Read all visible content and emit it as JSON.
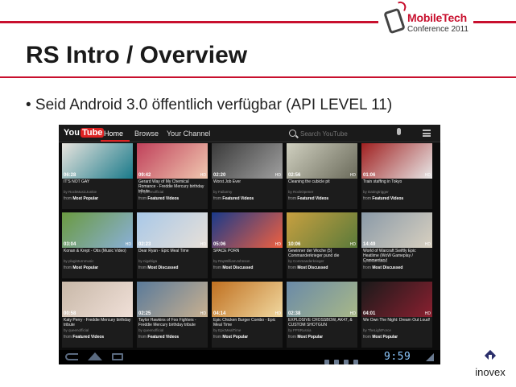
{
  "slide": {
    "title": "RS Intro / Overview",
    "bullet": "• Seid Android 3.0 öffentlich verfügbar (API LEVEL 11)",
    "conference_logo": {
      "line1": "MobileTech",
      "line2": "Conference 2011"
    },
    "company_logo": "inovex",
    "accent_color": "#c8102e"
  },
  "youtube_app": {
    "logo": {
      "you": "You",
      "tube": "Tube"
    },
    "nav_tabs": [
      {
        "label": "Home",
        "active": true
      },
      {
        "label": "Browse",
        "active": false
      },
      {
        "label": "Your Channel",
        "active": false
      }
    ],
    "search": {
      "placeholder": "Search YouTube"
    },
    "videos": [
      {
        "title": "IT'S NOT GAY",
        "duration": "06:28",
        "by": "by RockMusicJunkie",
        "feed_prefix": "from",
        "feed": "Most Popular",
        "hd": "",
        "badge": "",
        "colors": [
          "#e8e4de",
          "#1a7a8a"
        ]
      },
      {
        "title": "Gerard Way of My Chemical Romance - Freddie Mercury birthday tribute",
        "duration": "09:42",
        "by": "by queenofficial",
        "feed_prefix": "from",
        "feed": "Featured Videos",
        "hd": "HD",
        "badge": "",
        "colors": [
          "#c0405a",
          "#f0c8b0"
        ]
      },
      {
        "title": "Worst Job Ever",
        "duration": "02:20",
        "by": "by Failarmy",
        "feed_prefix": "from",
        "feed": "Featured Videos",
        "hd": "HD",
        "badge": "",
        "colors": [
          "#3a3a3a",
          "#a0a0a0"
        ]
      },
      {
        "title": "Cleaning the cubicle pit",
        "duration": "02:56",
        "by": "by RockOpener",
        "feed_prefix": "from",
        "feed": "Featured Videos",
        "hd": "HD",
        "badge": "",
        "colors": [
          "#d0d0c0",
          "#6a6a5a"
        ]
      },
      {
        "title": "Train staffing in Tokyo",
        "duration": "01:06",
        "by": "by Datingtrigger",
        "feed_prefix": "from",
        "feed": "Featured Videos",
        "hd": "HD",
        "badge": "",
        "colors": [
          "#a02020",
          "#e8e8e8"
        ]
      },
      {
        "title": "Konan & Krept - Otis (Music Video)",
        "duration": "03:04",
        "by": "by pluginturnmusic",
        "feed_prefix": "from",
        "feed": "Most Popular",
        "hd": "HD",
        "badge": "",
        "colors": [
          "#6a9a40",
          "#8ab0d8"
        ]
      },
      {
        "title": "Dear Ryan - Epic Meal Time",
        "duration": "02:23",
        "by": "by nigahiga",
        "feed_prefix": "from",
        "feed": "Most Discussed",
        "hd": "HD",
        "badge": "",
        "colors": [
          "#a8c8e8",
          "#e8e0d8"
        ]
      },
      {
        "title": "SPACE PORN",
        "duration": "05:06",
        "by": "by RayWilliamJohnson",
        "feed_prefix": "from",
        "feed": "Most Discussed",
        "hd": "HD",
        "badge": "",
        "colors": [
          "#1a3a8a",
          "#f06040"
        ]
      },
      {
        "title": "Gewinner der Woche (5) Commanderkrieger pund die",
        "duration": "10:06",
        "by": "by Commanderkrieger",
        "feed_prefix": "from",
        "feed": "Most Discussed",
        "hd": "HD",
        "badge": "",
        "colors": [
          "#c8a040",
          "#5a7a3a"
        ]
      },
      {
        "title": "World of Warcraft Swiftly Epic Heatlime (WoW Gameplay / Commentary)",
        "duration": "14:49",
        "by": "by Jesse Cox",
        "feed_prefix": "from",
        "feed": "Most Discussed",
        "hd": "HD",
        "badge": "",
        "colors": [
          "#8a9aa8",
          "#d8d0c0"
        ]
      },
      {
        "title": "Katy Perry - Freddie Mercury birthday tribute",
        "duration": "00:58",
        "by": "by queenofficial",
        "feed_prefix": "from",
        "feed": "Featured Videos",
        "hd": "",
        "badge": "",
        "colors": [
          "#c8b8a8",
          "#f0e0d8"
        ]
      },
      {
        "title": "Taylor Hawkins of Foo Fighters - Freddie Mercury birthday tribute",
        "duration": "02:25",
        "by": "by queenofficial",
        "feed_prefix": "from",
        "feed": "Featured Videos",
        "hd": "HD",
        "badge": "",
        "colors": [
          "#5a7a9a",
          "#c8b090"
        ]
      },
      {
        "title": "Epic Chicken Burger Combo - Epic Meal Time",
        "duration": "04:14",
        "by": "by EpicMealTime",
        "feed_prefix": "from",
        "feed": "Most Popular",
        "hd": "HD",
        "badge": "",
        "colors": [
          "#c07020",
          "#f0d8a0"
        ]
      },
      {
        "title": "EXPLOSIVE CROSSBOW, AK47, & CUSTOM SHOTGUN",
        "duration": "02:38",
        "by": "by FPSRussia",
        "feed_prefix": "from",
        "feed": "Most Popular",
        "hd": "HD",
        "badge": "",
        "colors": [
          "#6a8aa8",
          "#a8b888"
        ]
      },
      {
        "title": "We Own The Night: Dream Out Loud!",
        "duration": "04:01",
        "by": "by TheLightForce",
        "feed_prefix": "from",
        "feed": "Most Popular",
        "hd": "HD",
        "badge": "",
        "colors": [
          "#1a1a1a",
          "#8a2030"
        ]
      }
    ]
  },
  "system_bar": {
    "clock": "9:59"
  }
}
